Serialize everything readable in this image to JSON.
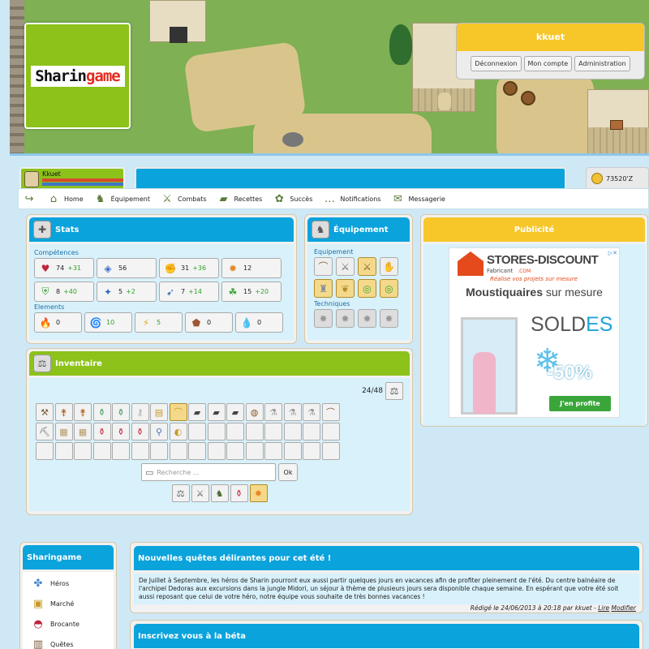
{
  "header": {
    "logo": {
      "part1": "Sharin",
      "part2": "game"
    },
    "user": {
      "name": "kkuet",
      "buttons": [
        "Déconnexion",
        "Mon compte",
        "Administration"
      ]
    }
  },
  "character": {
    "name": "Kkuet",
    "money": "73520'Z"
  },
  "nav": [
    {
      "icon": "back-arrow-icon",
      "glyph": "↪",
      "label": ""
    },
    {
      "icon": "home-sign-icon",
      "glyph": "⌂",
      "label": "Home"
    },
    {
      "icon": "armor-icon",
      "glyph": "♞",
      "label": "Équipement"
    },
    {
      "icon": "crossed-swords-icon",
      "glyph": "⚔",
      "label": "Combats"
    },
    {
      "icon": "recipe-book-icon",
      "glyph": "▰",
      "label": "Recettes"
    },
    {
      "icon": "trophy-icon",
      "glyph": "✿",
      "label": "Succès"
    },
    {
      "icon": "chat-bubble-icon",
      "glyph": "…",
      "label": "Notifications"
    },
    {
      "icon": "envelope-icon",
      "glyph": "✉",
      "label": "Messagerie"
    }
  ],
  "stats": {
    "title": "Stats",
    "competences_label": "Compétences",
    "elements_label": "Elements",
    "competences": [
      {
        "icon": "heart-icon",
        "glyph": "♥",
        "color": "#c0233a",
        "value": "74",
        "bonus": "+31"
      },
      {
        "icon": "shield-icon",
        "glyph": "◈",
        "color": "#3d6fc7",
        "value": "56",
        "bonus": ""
      },
      {
        "icon": "fist-icon",
        "glyph": "✊",
        "color": "#caa072",
        "value": "31",
        "bonus": "+36"
      },
      {
        "icon": "spark-icon",
        "glyph": "✹",
        "color": "#e8862a",
        "value": "12",
        "bonus": ""
      },
      {
        "icon": "green-shield-icon",
        "glyph": "⛨",
        "color": "#3aa63a",
        "value": "8",
        "bonus": "+40"
      },
      {
        "icon": "blue-star-icon",
        "glyph": "✦",
        "color": "#2f6fc6",
        "value": "5",
        "bonus": "+2"
      },
      {
        "icon": "running-boot-icon",
        "glyph": "➹",
        "color": "#4a6fb0",
        "value": "7",
        "bonus": "+14"
      },
      {
        "icon": "clover-icon",
        "glyph": "☘",
        "color": "#3aa63a",
        "value": "15",
        "bonus": "+20"
      }
    ],
    "elements": [
      {
        "icon": "fire-icon",
        "glyph": "🔥",
        "color": "#e05a1c",
        "value": "0",
        "bonus": false
      },
      {
        "icon": "tornado-icon",
        "glyph": "🌀",
        "color": "#3aa63a",
        "value": "10",
        "bonus": true
      },
      {
        "icon": "lightning-icon",
        "glyph": "⚡",
        "color": "#e0b01c",
        "value": "5",
        "bonus": true
      },
      {
        "icon": "rock-icon",
        "glyph": "⬟",
        "color": "#a0582f",
        "value": "0",
        "bonus": false
      },
      {
        "icon": "water-drop-icon",
        "glyph": "💧",
        "color": "#3d9fe0",
        "value": "0",
        "bonus": false
      }
    ]
  },
  "equipment": {
    "title": "Équipement",
    "equip_label": "Equipement",
    "tech_label": "Techniques",
    "slots": [
      {
        "icon": "hat-icon",
        "glyph": "⌒",
        "color": "#8a6a4a",
        "gold": false
      },
      {
        "icon": "sword-icon",
        "glyph": "⚔",
        "color": "#666",
        "gold": false
      },
      {
        "icon": "gold-sword-icon",
        "glyph": "⚔",
        "color": "#7a5a2a",
        "gold": true
      },
      {
        "icon": "gauntlet-icon",
        "glyph": "✋",
        "color": "#8a5a3a",
        "gold": false
      },
      {
        "icon": "armor-plate-icon",
        "glyph": "♜",
        "color": "#7a8aa0",
        "gold": true
      },
      {
        "icon": "feather-icon",
        "glyph": "❦",
        "color": "#b08b2a",
        "gold": true
      },
      {
        "icon": "green-ring-icon",
        "glyph": "◎",
        "color": "#3aa63a",
        "gold": true
      },
      {
        "icon": "green-ring-icon-2",
        "glyph": "◎",
        "color": "#3aa63a",
        "gold": true
      }
    ],
    "techniques": [
      {
        "icon": "technique-slot-icon-1",
        "glyph": "✸"
      },
      {
        "icon": "technique-slot-icon-2",
        "glyph": "✸"
      },
      {
        "icon": "technique-slot-icon-3",
        "glyph": "✸"
      },
      {
        "icon": "technique-slot-icon-4",
        "glyph": "✸"
      }
    ]
  },
  "inventory": {
    "title": "Inventaire",
    "count": "24/48",
    "search_placeholder": "Recherche ...",
    "ok_label": "Ok",
    "items": [
      {
        "icon": "axe-icon",
        "glyph": "⚒",
        "color": "#7a5a3a"
      },
      {
        "icon": "broom-icon",
        "glyph": "⚵",
        "color": "#b5652a"
      },
      {
        "icon": "broom-icon-2",
        "glyph": "⚵",
        "color": "#b5652a"
      },
      {
        "icon": "green-potion-icon",
        "glyph": "⚱",
        "color": "#3a9a5a"
      },
      {
        "icon": "green-potion-icon-2",
        "glyph": "⚱",
        "color": "#3a9a5a"
      },
      {
        "icon": "key-icon",
        "glyph": "⚷",
        "color": "#aaa"
      },
      {
        "icon": "hay-bale-icon",
        "glyph": "▤",
        "color": "#c79a2a"
      },
      {
        "icon": "yellow-hat-icon",
        "glyph": "⌒",
        "color": "#c79a2a",
        "hl": true
      },
      {
        "icon": "iron-bar-icon",
        "glyph": "▰",
        "color": "#444"
      },
      {
        "icon": "iron-bar-icon-2",
        "glyph": "▰",
        "color": "#444"
      },
      {
        "icon": "iron-bar-icon-3",
        "glyph": "▰",
        "color": "#444"
      },
      {
        "icon": "wood-barrel-icon",
        "glyph": "◍",
        "color": "#8a5a2a"
      },
      {
        "icon": "flask-icon",
        "glyph": "⚗",
        "color": "#999"
      },
      {
        "icon": "flask-icon-2",
        "glyph": "⚗",
        "color": "#999"
      },
      {
        "icon": "flask-icon-3",
        "glyph": "⚗",
        "color": "#999"
      },
      {
        "icon": "leather-hat-icon",
        "glyph": "⌒",
        "color": "#7a5a3a"
      },
      {
        "icon": "pickaxe-icon",
        "glyph": "⛏",
        "color": "#666"
      },
      {
        "icon": "map-scroll-icon",
        "glyph": "▦",
        "color": "#b39a6a"
      },
      {
        "icon": "map-scroll-icon-2",
        "glyph": "▦",
        "color": "#b39a6a"
      },
      {
        "icon": "red-potion-icon",
        "glyph": "⚱",
        "color": "#c0233a"
      },
      {
        "icon": "red-potion-icon-2",
        "glyph": "⚱",
        "color": "#c0233a"
      },
      {
        "icon": "red-potion-icon-3",
        "glyph": "⚱",
        "color": "#c0233a"
      },
      {
        "icon": "magnifier-icon",
        "glyph": "⚲",
        "color": "#4a6fb0"
      },
      {
        "icon": "bread-icon",
        "glyph": "◐",
        "color": "#c79a2a"
      }
    ],
    "quick": [
      {
        "icon": "bag-icon",
        "glyph": "⚖",
        "color": "#555",
        "hl": false
      },
      {
        "icon": "sword-filter-icon",
        "glyph": "⚔",
        "color": "#555",
        "hl": false
      },
      {
        "icon": "armor-filter-icon",
        "glyph": "♞",
        "color": "#4a6a2a",
        "hl": false
      },
      {
        "icon": "potion-filter-icon",
        "glyph": "⚱",
        "color": "#c0233a",
        "hl": false
      },
      {
        "icon": "spark-filter-icon",
        "glyph": "✹",
        "color": "#e8862a",
        "hl": true
      }
    ]
  },
  "ad": {
    "title": "Publicité",
    "brand": "STORES-DISCOUNT",
    "fabricant": "Fabricant",
    "com": ".COM",
    "tagline": "Réalise vos projets sur mesure",
    "mous_a": "Moustiquaires",
    "mous_b": " sur mesure",
    "soldes_a": "SOLD",
    "soldes_b": "ES",
    "pct": "-50%",
    "cta": "J'en profite"
  },
  "sidebar": {
    "title": "Sharingame",
    "items": [
      {
        "icon": "hero-icon",
        "glyph": "✤",
        "color": "#4a8ac9",
        "label": "Héros"
      },
      {
        "icon": "market-box-icon",
        "glyph": "▣",
        "color": "#c79a2a",
        "label": "Marché"
      },
      {
        "icon": "junk-shop-icon",
        "glyph": "◓",
        "color": "#c0233a",
        "label": "Brocante"
      },
      {
        "icon": "quest-book-icon",
        "glyph": "▥",
        "color": "#7a5a3a",
        "label": "Quêtes"
      }
    ]
  },
  "news": [
    {
      "title": "Nouvelles quêtes délirantes pour cet été !",
      "body": "De Juillet à Septembre, les héros de Sharin pourront eux aussi partir quelques jours en vacances afin de profiter pleinement de l'été. Du centre balnéaire de l'archipel Dedoras aux excursions dans la jungle Midori, un séjour à thème de plusieurs jours sera disponible chaque semaine. En espérant que votre été soit aussi reposant que celui de votre héro, notre équipe vous souhaite de très bonnes vacances !",
      "signature": "Rédigé le 24/06/2013 à 20:18 par kkuet - ",
      "read": "Lire",
      "edit": "Modifier"
    },
    {
      "title": "Inscrivez vous à la béta"
    }
  ],
  "colors": {
    "blue": "#0aa3dc",
    "green": "#8cc21a",
    "yellow": "#f7c72a",
    "bonus": "#31a32a"
  }
}
